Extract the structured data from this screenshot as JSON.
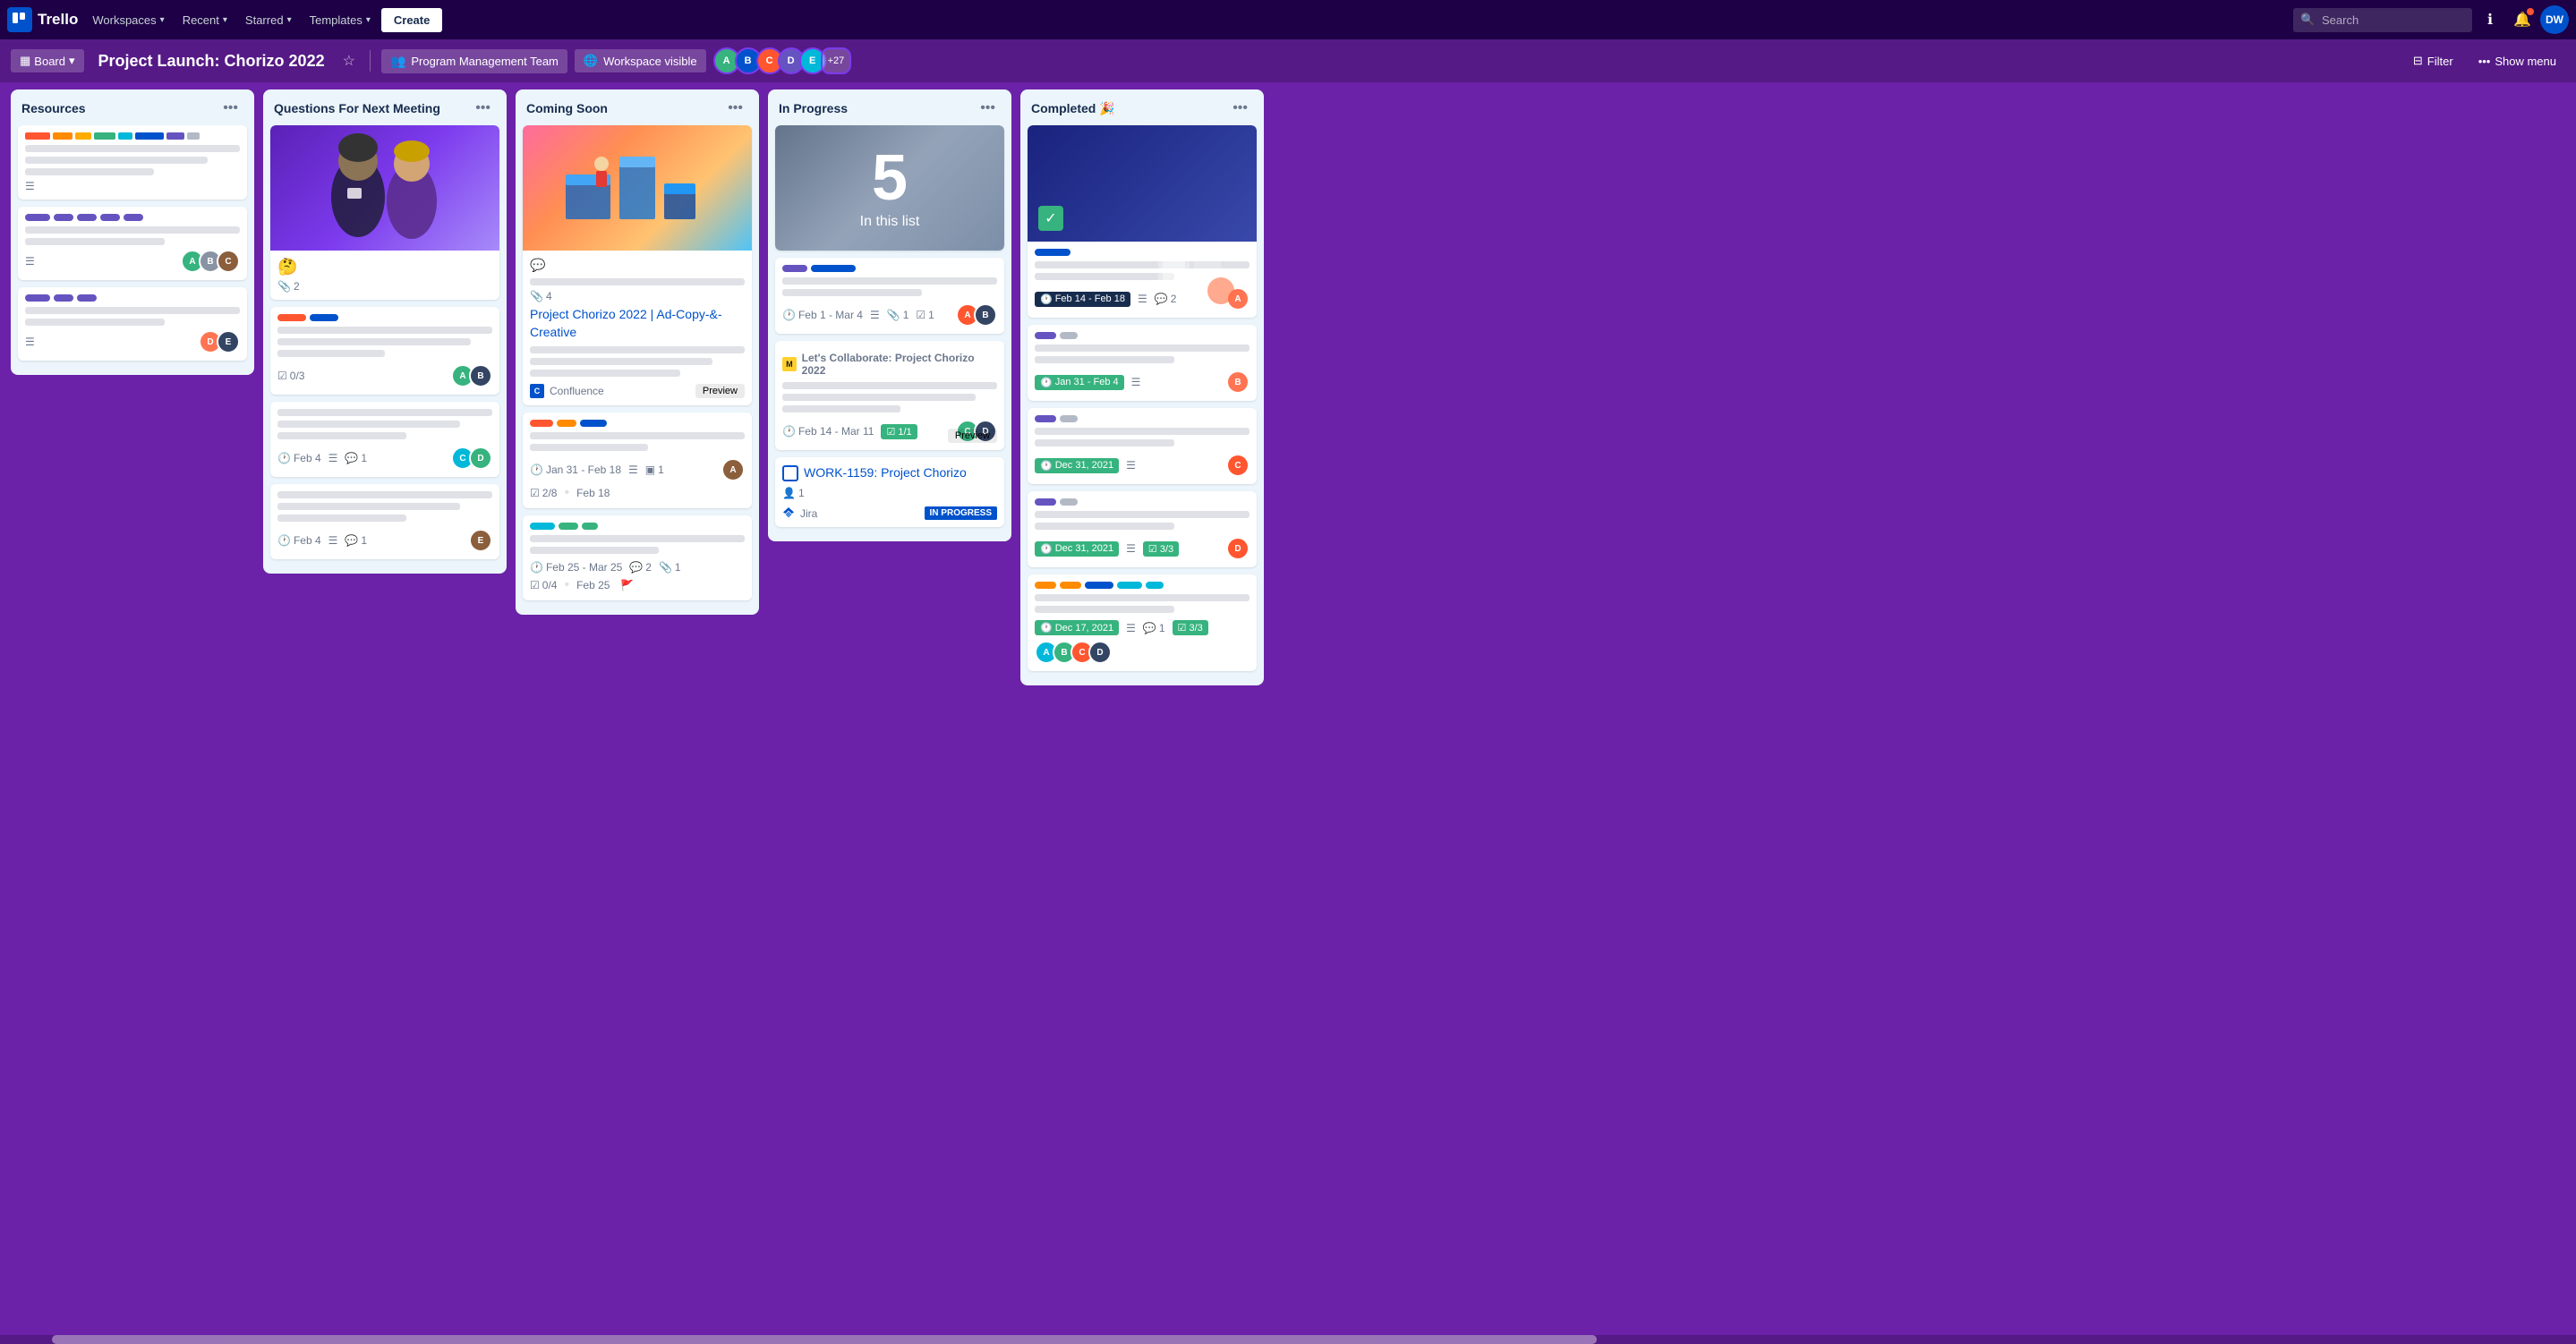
{
  "nav": {
    "logo_text": "Trello",
    "workspaces_label": "Workspaces",
    "recent_label": "Recent",
    "starred_label": "Starred",
    "templates_label": "Templates",
    "create_label": "Create",
    "search_placeholder": "Search",
    "info_icon": "ℹ",
    "notif_icon": "🔔",
    "avatar_initials": "DW"
  },
  "board_header": {
    "board_label": "Board",
    "title": "Project Launch: Chorizo 2022",
    "team_label": "Program Management Team",
    "workspace_label": "Workspace visible",
    "plus_count": "+27",
    "filter_label": "Filter",
    "show_menu_label": "Show menu"
  },
  "columns": [
    {
      "id": "resources",
      "title": "Resources",
      "cards": [
        {
          "type": "color_bars",
          "has_lines": true,
          "desc_lines": [
            "full",
            "short"
          ],
          "has_hamburger": true
        },
        {
          "type": "plain",
          "has_lines": true,
          "desc_lines": [
            "full",
            "short"
          ],
          "has_hamburger": true,
          "avatars": [
            "green",
            "dark",
            "brown"
          ]
        },
        {
          "type": "plain",
          "has_lines": true,
          "desc_lines": [
            "full",
            "short"
          ],
          "has_hamburger": true,
          "avatars": [
            "av-pink",
            "av-dark"
          ]
        }
      ]
    },
    {
      "id": "questions",
      "title": "Questions For Next Meeting",
      "cards": [
        {
          "type": "cover_people",
          "emoji": "🤔",
          "attachments": 2
        },
        {
          "type": "plain_labels",
          "labels": [
            "red",
            "blue"
          ],
          "desc_lines": [
            "full",
            "full",
            "shorter"
          ],
          "checklist": "0/3",
          "avatars": [
            "av-green",
            "av-dark"
          ]
        },
        {
          "type": "plain_lines",
          "desc_lines": [
            "full",
            "full",
            "medium"
          ],
          "date": "Feb 4",
          "hamburger": true,
          "comment": 1,
          "avatars": [
            "av-teal",
            "av-green"
          ]
        },
        {
          "type": "plain_lines",
          "desc_lines": [
            "full",
            "full",
            "medium"
          ],
          "date": "Feb 4",
          "hamburger": true,
          "comment": 1,
          "avatars": [
            "av-brown"
          ]
        }
      ]
    },
    {
      "id": "coming_soon",
      "title": "Coming Soon",
      "cards": [
        {
          "type": "cover_3d",
          "comment_icon": true,
          "attachments": 4,
          "title_link": "Project Chorizo 2022 | Ad-Copy-&-Creative",
          "desc_lines": [
            "full",
            "full",
            "full"
          ],
          "integration": "Confluence",
          "preview": true
        },
        {
          "type": "plain_colored_labels",
          "labels": [
            "red",
            "orange",
            "blue"
          ],
          "desc_lines": [
            "full",
            "short"
          ],
          "date": "Jan 31 - Feb 18",
          "checklist_val": "2/8",
          "checklist_date": "Feb 18",
          "hamburger": true,
          "cards_icon": 1,
          "avatar": "av-brown"
        },
        {
          "type": "green_label_cover",
          "labels": [
            "teal"
          ],
          "desc_lines": [
            "full",
            "short"
          ],
          "date": "Feb 25 - Mar 25",
          "comments": 2,
          "attachments": 1,
          "checklist": "0/4",
          "checklist_date": "Feb 25",
          "flag_icon": true
        }
      ]
    },
    {
      "id": "in_progress",
      "title": "In Progress",
      "cards": [
        {
          "type": "cover_5",
          "five_text": "5",
          "in_this_list": "In this list"
        },
        {
          "type": "integration_card",
          "labels": [
            "purple",
            "blue_wide"
          ],
          "desc_lines": [
            "full",
            "short"
          ],
          "title": "",
          "date": "Feb 1 - Mar 4",
          "hamburger": true,
          "attachments": 1,
          "checklist": 1,
          "avatars": [
            "av-orange",
            "av-dark"
          ]
        },
        {
          "type": "miro_card",
          "logo": "miro",
          "title": "Let's Collaborate: Project Chorizo 2022",
          "desc_lines": [
            "full",
            "full",
            "shorter"
          ],
          "date": "Feb 14 - Mar 11",
          "checklist": "1/1",
          "avatars": [
            "av-green",
            "av-dark"
          ],
          "preview": true
        },
        {
          "type": "jira_card",
          "title": "WORK-1159: Project Chorizo",
          "has_checkbox": true,
          "members": 1,
          "integration_label": "Jira",
          "status": "IN PROGRESS"
        }
      ]
    },
    {
      "id": "completed",
      "title": "Completed 🎉",
      "cards": [
        {
          "type": "cover_dark",
          "has_check": true,
          "labels": [
            "blue_narrow"
          ],
          "desc_lines": [
            "full",
            "short"
          ],
          "date": "Feb 14 - Feb 18",
          "hamburger": true,
          "comments": 2,
          "avatar": "av-pink"
        },
        {
          "type": "labeled",
          "labels": [
            "purple_narrow",
            "grey_narrow"
          ],
          "desc_lines": [
            "full",
            "short"
          ],
          "date_green": "Jan 31 - Feb 4",
          "hamburger": true,
          "avatar": "av-pink"
        },
        {
          "type": "labeled",
          "labels": [
            "purple_narrow",
            "grey_narrow"
          ],
          "desc_lines": [
            "full",
            "short"
          ],
          "date_green": "Dec 31, 2021",
          "hamburger": true,
          "avatar": "av-orange"
        },
        {
          "type": "labeled_checklist",
          "labels": [
            "purple_narrow",
            "grey_narrow"
          ],
          "desc_lines": [
            "full",
            "short"
          ],
          "date_green": "Dec 31, 2021",
          "hamburger": true,
          "checklist": "3/3",
          "avatar": "av-orange"
        },
        {
          "type": "multi_label",
          "labels": [
            "orange",
            "orange",
            "blue",
            "teal",
            "teal"
          ],
          "desc_lines": [
            "full",
            "short"
          ],
          "date_green": "Dec 17, 2021",
          "hamburger": true,
          "comments": 1,
          "checklist": "3/3",
          "avatars": [
            "av-teal",
            "av-green",
            "av-orange",
            "av-dark"
          ]
        }
      ]
    }
  ]
}
